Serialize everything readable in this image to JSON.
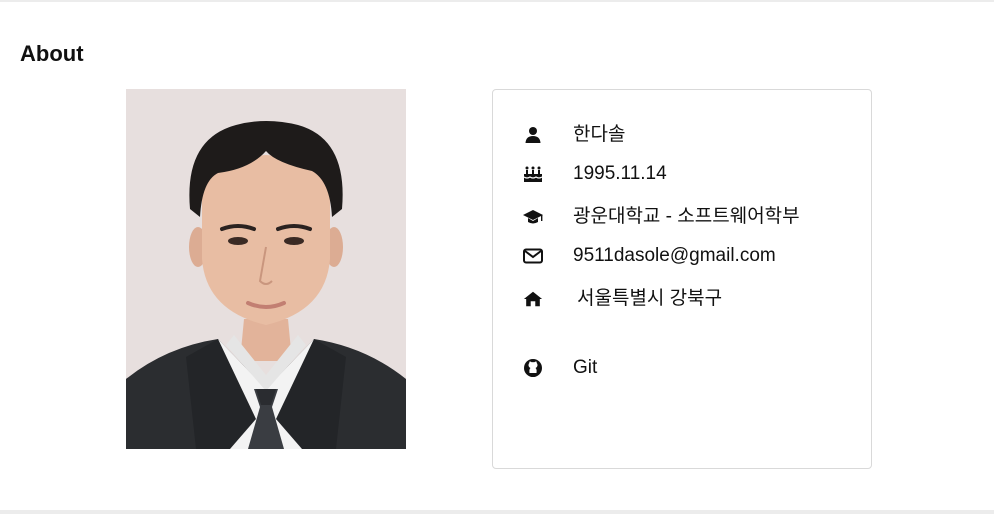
{
  "section": {
    "title": "About"
  },
  "photo": {
    "alt": "profile photo"
  },
  "profile": {
    "name": "한다솔",
    "birthday": "1995.11.14",
    "education": "광운대학교 - 소프트웨어학부",
    "email": "9511dasole@gmail.com",
    "address": "서울특별시 강북구",
    "git": "Git"
  },
  "icons": {
    "name": "user-icon",
    "birthday": "birthday-cake-icon",
    "education": "graduation-cap-icon",
    "email": "envelope-icon",
    "address": "home-icon",
    "git": "github-icon"
  },
  "colors": {
    "text": "#111111",
    "card_border": "#d9d9d9",
    "photo_background": "#e8e0df"
  }
}
